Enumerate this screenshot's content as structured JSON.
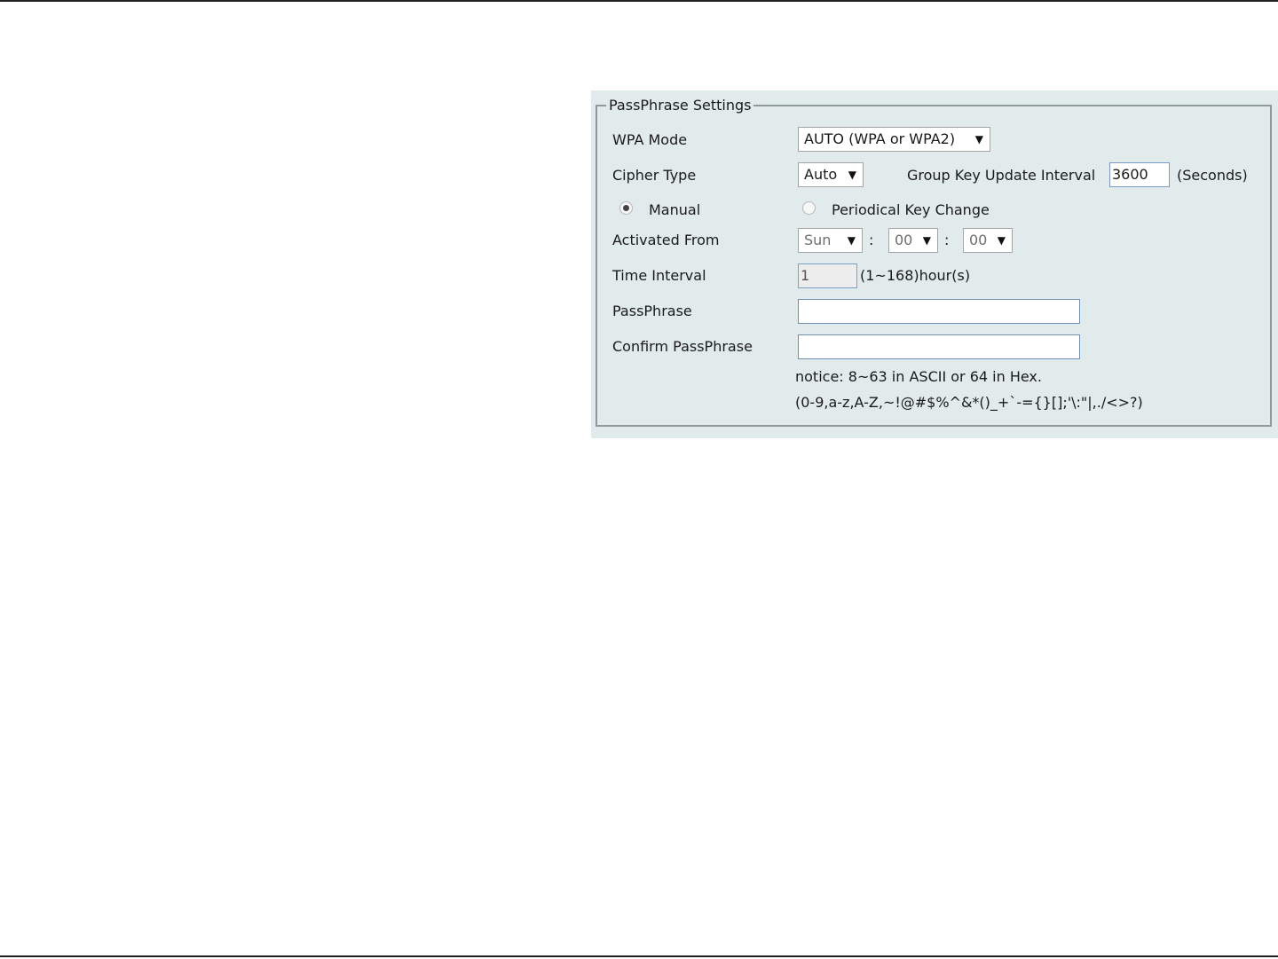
{
  "legend": "PassPhrase Settings",
  "wpa_mode": {
    "label": "WPA Mode",
    "value": "AUTO (WPA or WPA2)"
  },
  "cipher_type": {
    "label": "Cipher Type",
    "value": "Auto",
    "group_key_label": "Group Key Update Interval",
    "group_key_value": "3600",
    "group_key_unit": "(Seconds)"
  },
  "key_mode": {
    "manual_label": "Manual",
    "periodical_label": "Periodical Key Change",
    "selected": "Manual"
  },
  "activated_from": {
    "label": "Activated From",
    "day": "Sun",
    "hour": "00",
    "minute": "00",
    "separator": ":"
  },
  "time_interval": {
    "label": "Time Interval",
    "value": "1",
    "range_text": "(1~168)hour(s)"
  },
  "passphrase": {
    "label": "PassPhrase",
    "value": ""
  },
  "confirm_passphrase": {
    "label": "Confirm PassPhrase",
    "value": ""
  },
  "notice": {
    "line1": "notice: 8~63 in ASCII or 64 in Hex.",
    "line2": "(0-9,a-z,A-Z,~!@#$%^&*()_+`-={}[];'\\:\"|,./<>?)"
  },
  "icons": {
    "dropdown": "▼"
  }
}
